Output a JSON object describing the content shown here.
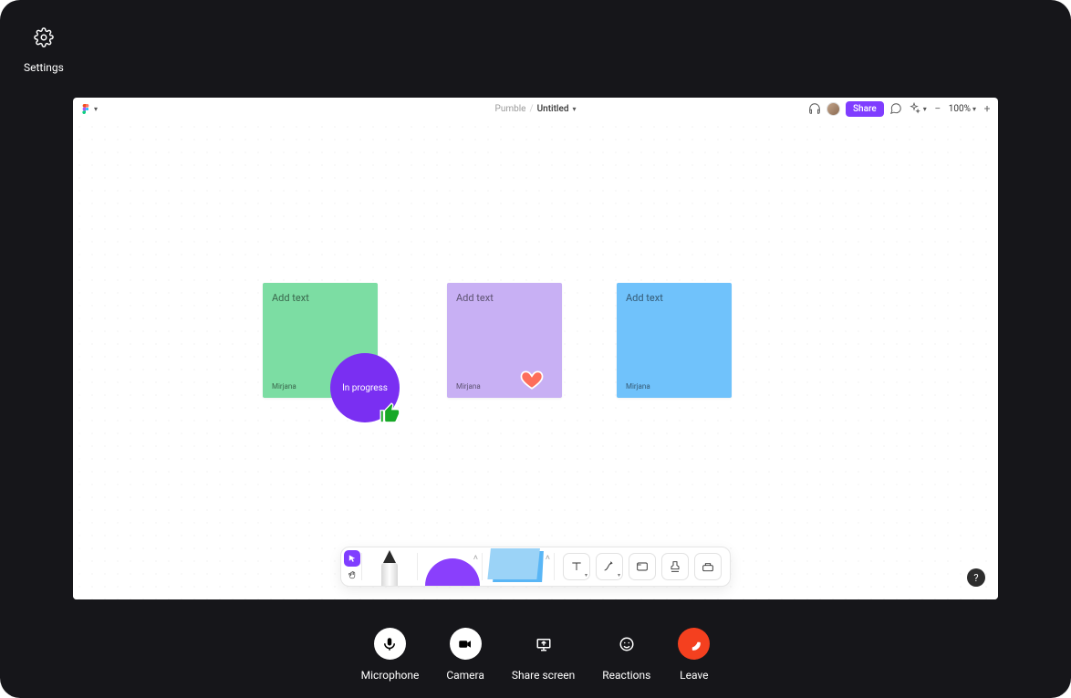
{
  "topleft": {
    "settings_label": "Settings"
  },
  "board": {
    "breadcrumb": {
      "workspace": "Pumble",
      "file": "Untitled"
    },
    "share_label": "Share",
    "zoom": "100%"
  },
  "stickies": [
    {
      "placeholder": "Add text",
      "author": "Mirjana",
      "color": "green"
    },
    {
      "placeholder": "Add text",
      "author": "Mirjana",
      "color": "purple"
    },
    {
      "placeholder": "Add text",
      "author": "Mirjana",
      "color": "blue"
    }
  ],
  "progress_badge": {
    "label": "In progress"
  },
  "help": {
    "label": "?"
  },
  "call": {
    "microphone": "Microphone",
    "camera": "Camera",
    "share_screen": "Share screen",
    "reactions": "Reactions",
    "leave": "Leave"
  }
}
